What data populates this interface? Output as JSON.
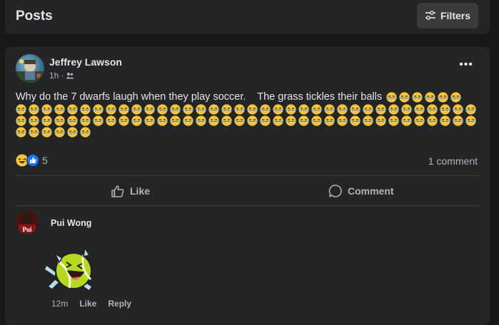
{
  "header": {
    "title": "Posts",
    "filters_label": "Filters"
  },
  "post": {
    "author": "Jeffrey Lawson",
    "time": "1h",
    "separator": "·",
    "audience_icon": "friends-icon",
    "text": "Why do the 7 dwarfs laugh when they play soccer.    The grass tickles their balls",
    "emoji_icon": "laughing-emoji-icon",
    "emoji_first_line_count": 6,
    "emoji_rows": [
      36,
      36,
      6
    ],
    "reaction_count": "5",
    "reaction_icons": [
      "haha-reaction-icon",
      "like-reaction-icon"
    ],
    "comment_count_label": "1 comment",
    "actions": {
      "like": "Like",
      "comment": "Comment"
    }
  },
  "comment": {
    "author": "Pui Wong",
    "avatar_text": "Pui",
    "time": "12m",
    "like": "Like",
    "reply": "Reply",
    "sticker": "tennis-ball-laughing-sticker"
  },
  "colors": {
    "background": "#18191a",
    "card": "#242526",
    "text": "#e4e6eb",
    "muted": "#b0b3b8"
  }
}
